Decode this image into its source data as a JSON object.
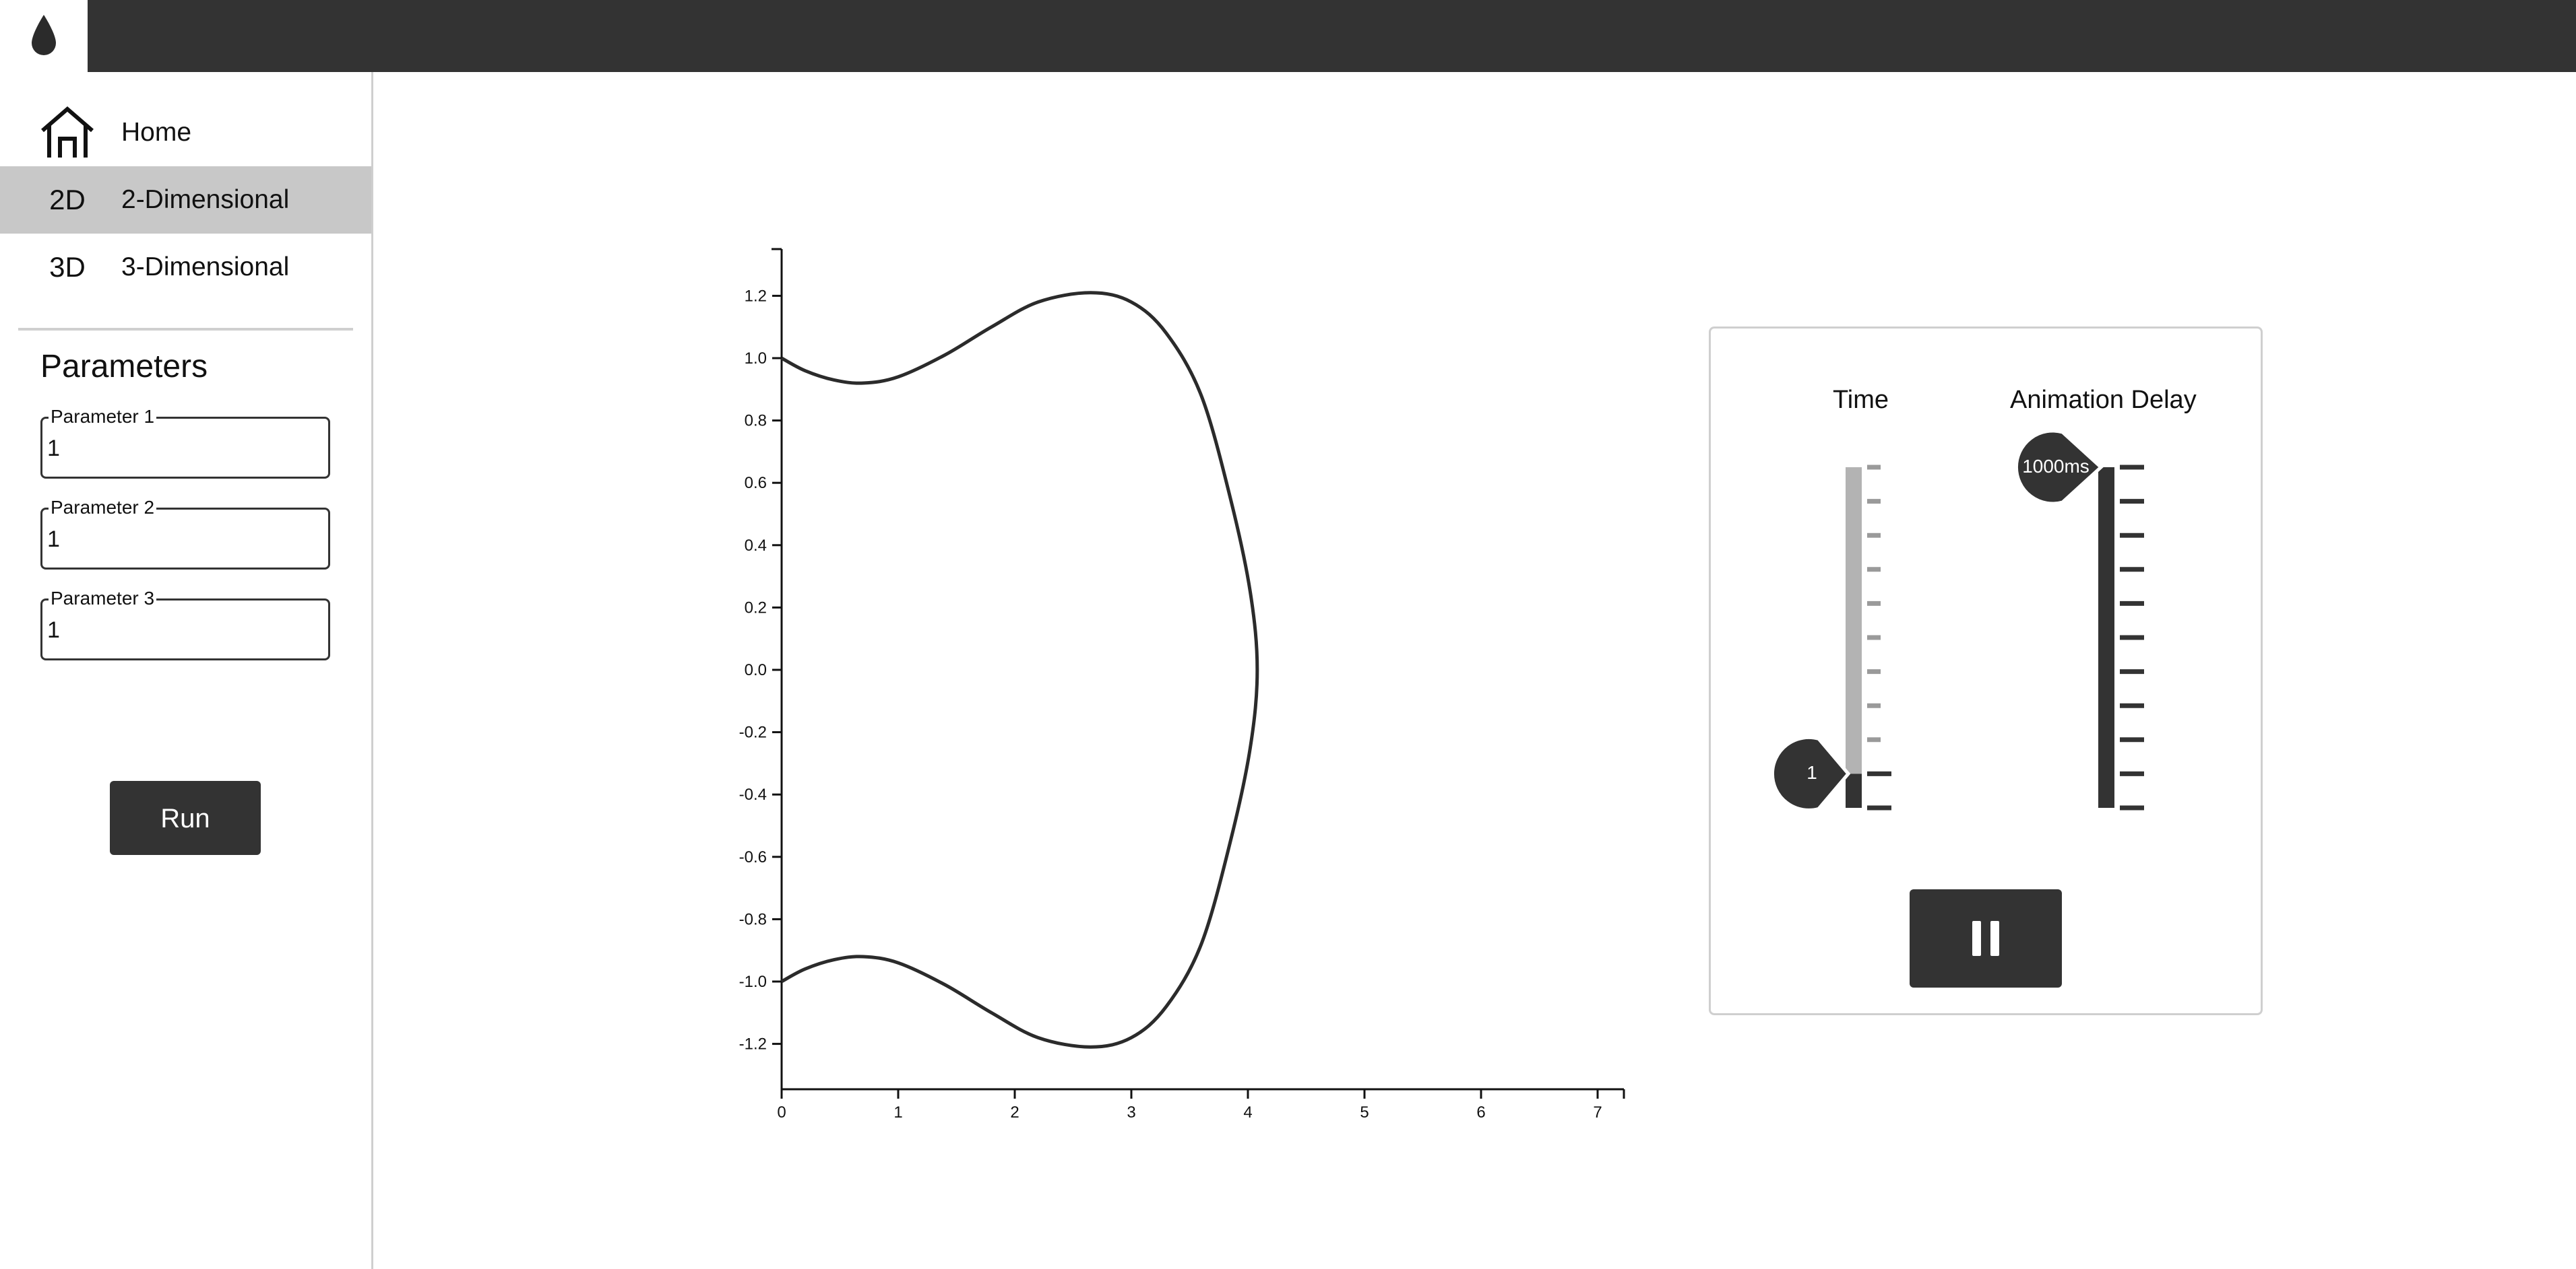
{
  "topbar": {
    "logo_icon": "droplet-icon",
    "background": "#333333"
  },
  "sidebar": {
    "items": [
      {
        "icon": "home-icon",
        "icon_text": "",
        "label": "Home",
        "active": false
      },
      {
        "icon": "2d-icon",
        "icon_text": "2D",
        "label": "2-Dimensional",
        "active": true
      },
      {
        "icon": "3d-icon",
        "icon_text": "3D",
        "label": "3-Dimensional",
        "active": false
      }
    ],
    "parameters_title": "Parameters",
    "parameters": [
      {
        "label": "Parameter 1",
        "value": "1"
      },
      {
        "label": "Parameter 2",
        "value": "1"
      },
      {
        "label": "Parameter 3",
        "value": "1"
      }
    ],
    "run_label": "Run"
  },
  "chart_data": {
    "type": "line",
    "title": "",
    "xlabel": "",
    "ylabel": "",
    "xlim": [
      0,
      7.2
    ],
    "ylim": [
      -1.35,
      1.35
    ],
    "x_ticks": [
      "0",
      "1",
      "2",
      "3",
      "4",
      "5",
      "6",
      "7"
    ],
    "y_ticks": [
      "1.2",
      "1.0",
      "0.8",
      "0.6",
      "0.4",
      "0.2",
      "0.0",
      "-0.2",
      "-0.4",
      "-0.6",
      "-0.8",
      "-1.0",
      "-1.2"
    ],
    "grid": false,
    "series": [
      {
        "points": [
          [
            0,
            1.0
          ],
          [
            0.2,
            0.96
          ],
          [
            0.45,
            0.93
          ],
          [
            0.7,
            0.92
          ],
          [
            1.0,
            0.94
          ],
          [
            1.4,
            1.01
          ],
          [
            1.8,
            1.1
          ],
          [
            2.2,
            1.18
          ],
          [
            2.65,
            1.21
          ],
          [
            3.0,
            1.18
          ],
          [
            3.3,
            1.08
          ],
          [
            3.6,
            0.88
          ],
          [
            3.85,
            0.55
          ],
          [
            4.02,
            0.25
          ],
          [
            4.08,
            0.0
          ],
          [
            4.02,
            -0.25
          ],
          [
            3.85,
            -0.55
          ],
          [
            3.6,
            -0.88
          ],
          [
            3.3,
            -1.08
          ],
          [
            3.0,
            -1.18
          ],
          [
            2.65,
            -1.21
          ],
          [
            2.2,
            -1.18
          ],
          [
            1.8,
            -1.1
          ],
          [
            1.4,
            -1.01
          ],
          [
            1.0,
            -0.94
          ],
          [
            0.7,
            -0.92
          ],
          [
            0.45,
            -0.93
          ],
          [
            0.2,
            -0.96
          ],
          [
            0,
            -1.0
          ]
        ]
      }
    ]
  },
  "controls": {
    "time": {
      "title": "Time",
      "value": 1,
      "value_label": "1",
      "min": 0,
      "max": 10,
      "position_fraction": 0.1
    },
    "delay": {
      "title": "Animation Delay",
      "value_label": "1000ms",
      "position_fraction": 1.0
    },
    "pause_icon": "pause-icon"
  }
}
